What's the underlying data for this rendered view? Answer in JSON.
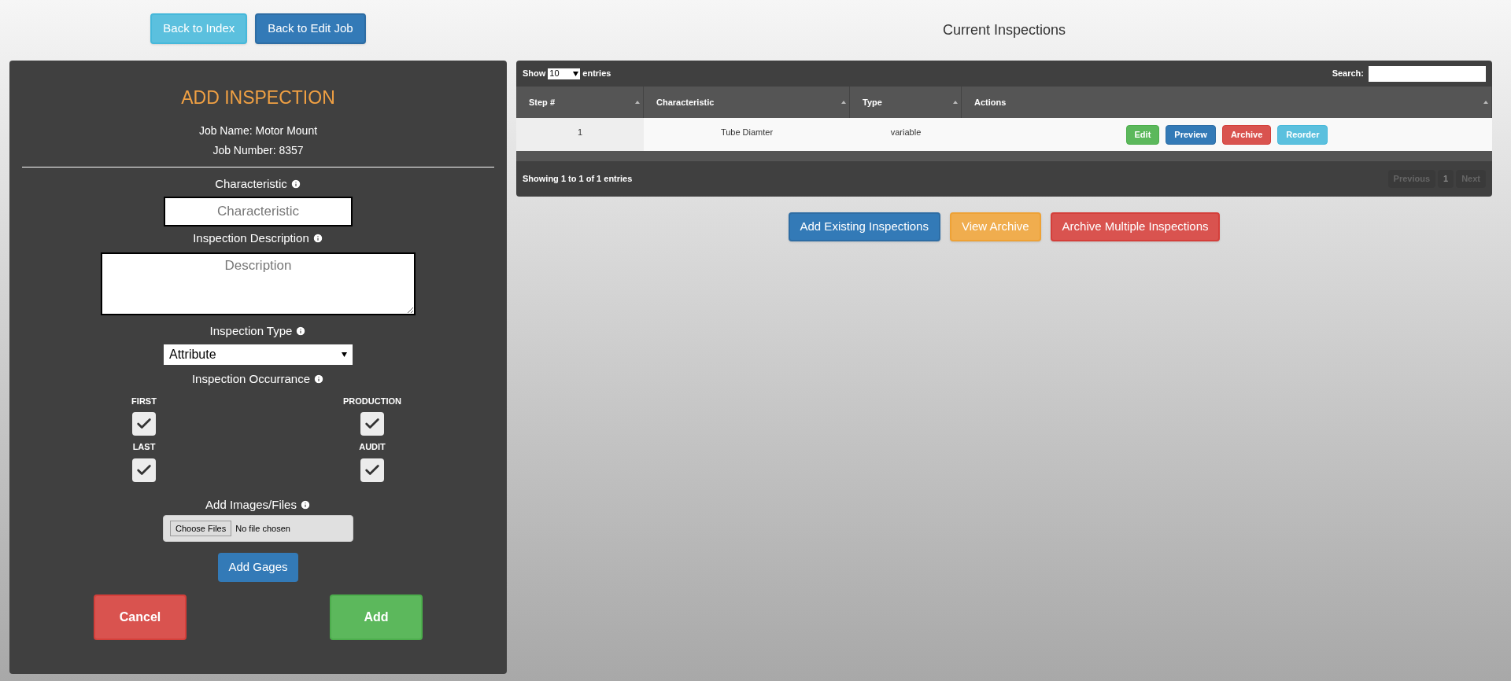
{
  "nav_buttons": [
    {
      "label": "Back to Index",
      "kind": "info"
    },
    {
      "label": "Back to Edit Job",
      "kind": "primary"
    }
  ],
  "form": {
    "title": "ADD INSPECTION",
    "job_name": "Job Name: Motor Mount",
    "job_number": "Job Number: 8357",
    "characteristic": {
      "label": "Characteristic",
      "placeholder": "Characteristic"
    },
    "description": {
      "label": "Inspection Description",
      "placeholder": "Description"
    },
    "inspection_type": {
      "label": "Inspection Type",
      "value": "Attribute"
    },
    "occurrence": {
      "label": "Inspection Occurrance",
      "options": [
        {
          "label": "FIRST",
          "checked": true
        },
        {
          "label": "PRODUCTION",
          "checked": true
        },
        {
          "label": "LAST",
          "checked": true
        },
        {
          "label": "AUDIT",
          "checked": true
        }
      ]
    },
    "files": {
      "label": "Add Images/Files",
      "button": "Choose Files",
      "status": "No file chosen"
    },
    "add_gages": "Add Gages",
    "cancel": "Cancel",
    "add": "Add"
  },
  "table": {
    "title": "Current Inspections",
    "show_label": "Show",
    "page_size": "10",
    "entries_label": "entries",
    "search_label": "Search:",
    "columns": [
      "Step #",
      "Characteristic",
      "Type",
      "Actions"
    ],
    "rows": [
      {
        "step": "1",
        "characteristic": "Tube Diamter",
        "type": "variable",
        "actions": [
          {
            "label": "Edit",
            "kind": "success"
          },
          {
            "label": "Preview",
            "kind": "primary"
          },
          {
            "label": "Archive",
            "kind": "danger"
          },
          {
            "label": "Reorder",
            "kind": "info"
          }
        ]
      }
    ],
    "info": "Showing 1 to 1 of 1 entries",
    "pagination": [
      {
        "label": "Previous",
        "disabled": true
      },
      {
        "label": "1",
        "disabled": false
      },
      {
        "label": "Next",
        "disabled": true
      }
    ]
  },
  "bottom_buttons": [
    {
      "label": "Add Existing Inspections",
      "kind": "primary"
    },
    {
      "label": "View Archive",
      "kind": "warning"
    },
    {
      "label": "Archive Multiple Inspections",
      "kind": "danger"
    }
  ]
}
